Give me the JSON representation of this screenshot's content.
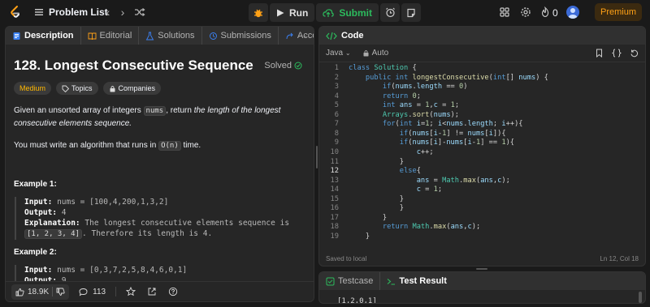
{
  "topbar": {
    "problem_list_label": "Problem List",
    "run_label": "Run",
    "submit_label": "Submit",
    "streak_count": "0",
    "premium_label": "Premium"
  },
  "left": {
    "tabs": [
      {
        "label": "Description"
      },
      {
        "label": "Editorial"
      },
      {
        "label": "Solutions"
      },
      {
        "label": "Submissions"
      },
      {
        "label": "Accepted"
      }
    ],
    "more": "···",
    "title": "128. Longest Consecutive Sequence",
    "solved_label": "Solved",
    "tags": {
      "difficulty": "Medium",
      "topics": "Topics",
      "companies": "Companies"
    },
    "desc1_a": "Given an unsorted array of integers ",
    "desc1_code": "nums",
    "desc1_b": ", return ",
    "desc1_em": "the length of the longest consecutive elements sequence.",
    "desc2_a": "You must write an algorithm that runs in ",
    "desc2_code": "O(n)",
    "desc2_b": " time.",
    "examples": [
      {
        "title": "Example 1:",
        "input_label": "Input:",
        "input": "nums = [100,4,200,1,3,2]",
        "output_label": "Output:",
        "output": "4",
        "expl_label": "Explanation:",
        "expl_a": "The longest consecutive elements sequence is ",
        "expl_code": "[1, 2, 3, 4]",
        "expl_b": ". Therefore its length is 4."
      },
      {
        "title": "Example 2:",
        "input_label": "Input:",
        "input": "nums = [0,3,7,2,5,8,4,6,0,1]",
        "output_label": "Output:",
        "output": "9"
      }
    ],
    "footer": {
      "likes": "18.9K",
      "comments": "113"
    }
  },
  "code": {
    "header": "Code",
    "language": "Java",
    "mode": "Auto",
    "lines": [
      "class Solution {",
      "    public int longestConsecutive(int[] nums) {",
      "        if(nums.length == 0)",
      "        return 0;",
      "        int ans = 1,c = 1;",
      "        Arrays.sort(nums);",
      "        for(int i=1; i<nums.length; i++){",
      "            if(nums[i-1] != nums[i]){",
      "            if(nums[i]-nums[i-1] == 1){",
      "                c++;",
      "            }",
      "            else{",
      "                ans = Math.max(ans,c);",
      "                c = 1;",
      "            }",
      "            }",
      "        }",
      "        return Math.max(ans,c);",
      "    }"
    ],
    "line_numbers": [
      "1",
      "2",
      "3",
      "4",
      "5",
      "6",
      "7",
      "8",
      "9",
      "10",
      "11",
      "12",
      "13",
      "14",
      "15",
      "16",
      "17",
      "18",
      "19"
    ],
    "current_line": 12,
    "status_left": "Saved to local",
    "status_right": "Ln 12, Col 18"
  },
  "bottom": {
    "testcase_label": "Testcase",
    "result_label": "Test Result",
    "peek": "[1,2,0,1]"
  },
  "colors": {
    "accent_orange": "#ffa116",
    "green": "#2cbb5d",
    "medium": "#ffb800"
  }
}
